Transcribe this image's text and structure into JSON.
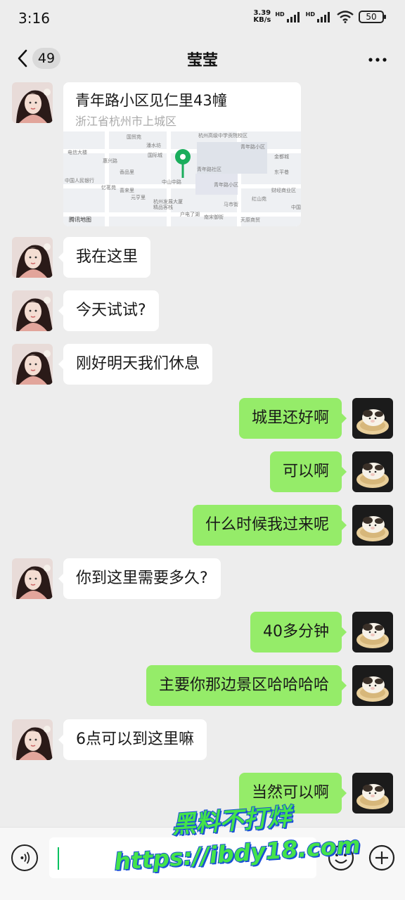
{
  "status_bar": {
    "time": "3:16",
    "net_speed_value": "3.39",
    "net_speed_unit": "KB/s",
    "hd_1": "HD",
    "hd_2": "HD",
    "battery": "50"
  },
  "header": {
    "back_icon": "chevron-left-icon",
    "unread_count": "49",
    "title": "莹莹",
    "more_icon": "more-dots-icon"
  },
  "location_message": {
    "name": "青年路小区见仁里43幢",
    "address": "浙江省杭州市上城区",
    "map_labels": [
      "国贸苑",
      "杭州高级中学贡院校区",
      "电信大楼",
      "潘水坊",
      "青年路小区",
      "惠兴路",
      "青年路社区",
      "香品里",
      "国际城",
      "金都城",
      "中国人民银行",
      "忆茗苑",
      "中山中路",
      "东平巷",
      "喜来里",
      "青年路小区",
      "财经商业区",
      "红山苑",
      "杭州发展大厦",
      "精品客栈",
      "元亨里",
      "户电了湖",
      "南宋御街",
      "中国",
      "天原商贸",
      "马市街",
      "腾讯地图"
    ],
    "pin_icon": "map-pin-icon"
  },
  "messages": [
    {
      "side": "in",
      "text": "我在这里"
    },
    {
      "side": "in",
      "text": "今天试试?"
    },
    {
      "side": "in",
      "text": "刚好明天我们休息"
    },
    {
      "side": "out",
      "text": "城里还好啊"
    },
    {
      "side": "out",
      "text": "可以啊"
    },
    {
      "side": "out",
      "text": "什么时候我过来呢"
    },
    {
      "side": "in",
      "text": "你到这里需要多久?"
    },
    {
      "side": "out",
      "text": "40多分钟"
    },
    {
      "side": "out",
      "text": "主要你那边景区哈哈哈哈"
    },
    {
      "side": "in",
      "text": "6点可以到这里嘛"
    },
    {
      "side": "out",
      "text": "当然可以啊"
    }
  ],
  "input_bar": {
    "voice_icon": "voice-icon",
    "emoji_icon": "emoji-icon",
    "plus_icon": "plus-icon",
    "input_value": ""
  },
  "watermark": {
    "line1": "黑料不打烊",
    "line2": "https://ibdy18.com"
  },
  "colors": {
    "background": "#ededed",
    "outgoing_bubble": "#95ec69",
    "incoming_bubble": "#ffffff",
    "accent": "#07c160"
  }
}
